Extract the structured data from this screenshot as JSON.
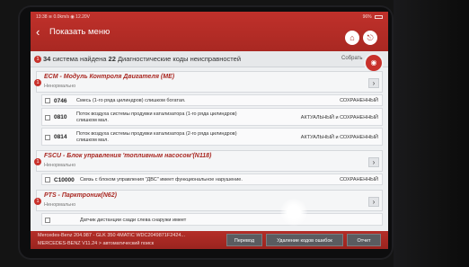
{
  "status_bar": {
    "time": "13:38",
    "wifi": "Wi-Fi",
    "signal": "0.0km/s",
    "voltage": "12.20V",
    "battery": "96%"
  },
  "header": {
    "title": "Показать меню"
  },
  "summary": {
    "systems_count": "34",
    "text_mid": "система найдена",
    "codes_count": "22",
    "text_tail": "Диагностические коды неисправностей",
    "badge": "1",
    "collect_label": "Собрать"
  },
  "systems": [
    {
      "badge": "1",
      "name": "ECM - Модуль Контроля Двигателя (ME)",
      "status": "Ненормально",
      "codes": [
        {
          "code": "0746",
          "desc": "Смесь (1-го ряда цилиндров) слишком богатая.",
          "state": "СОХРАНЕННЫЙ"
        },
        {
          "code": "0810",
          "desc": "Поток воздуха системы продувки катализатора (1-го ряда цилиндров) слишком мал.",
          "state": "АКТУАЛЬНЫЙ и СОХРАНЕННЫЙ"
        },
        {
          "code": "0814",
          "desc": "Поток воздуха системы продувки катализатора (2-го ряда цилиндров) слишком мал.",
          "state": "АКТУАЛЬНЫЙ и СОХРАНЕННЫЙ"
        }
      ]
    },
    {
      "badge": "1",
      "name": "FSCU - Блок управления 'топливным насосом'(N118)",
      "status": "Ненормально",
      "codes": [
        {
          "code": "C10000",
          "desc": "Связь с блоком управления \"ДВС\" имеет функциональное нарушение.",
          "state": "СОХРАНЕННЫЙ"
        }
      ]
    },
    {
      "badge": "1",
      "name": "PTS - Парктроник(N62)",
      "status": "Ненормально",
      "codes": [
        {
          "code": "",
          "desc": "Датчик дистанции сзади слева снаружи имеет",
          "state": ""
        }
      ]
    }
  ],
  "footer": {
    "vehicle_line1": "Mercedes-Benz  204.987 - GLK 350 4MATIC  WDC2049871F2424...",
    "vehicle_line2": "MERCEDES-BENZ V11.24 > автоматический поиск",
    "buttons": {
      "translate": "Перевод",
      "clear_codes": "Удаление кодов ошибок",
      "report": "Отчет"
    }
  },
  "colors": {
    "accent": "#a92822",
    "background": "#eef0f2"
  }
}
